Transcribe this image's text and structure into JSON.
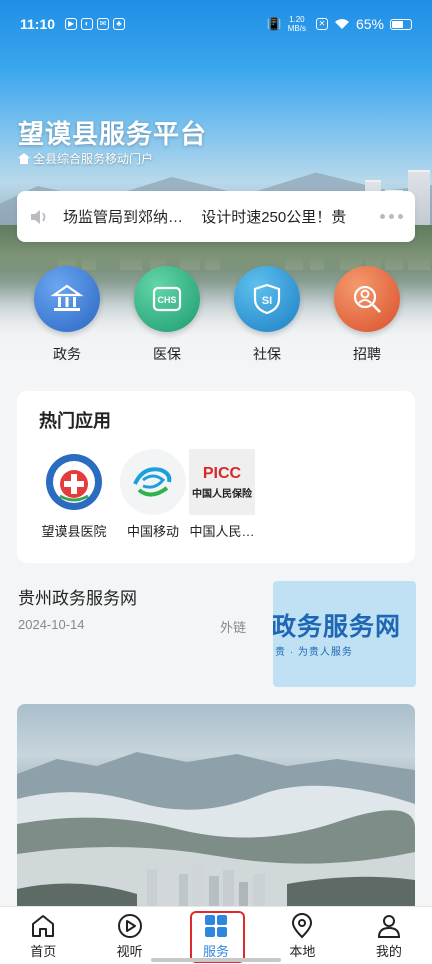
{
  "status_bar": {
    "time": "11:10",
    "net_speed_top": "1.20",
    "net_speed_unit": "MB/s",
    "battery": "65%",
    "battery_level": 0.65
  },
  "header": {
    "title": "望谟县服务平台",
    "subtitle": "全县综合服务移动门户"
  },
  "ticker": {
    "items": [
      "场监管局到郊纳…",
      "设计时速250公里！贵"
    ]
  },
  "quick_services": [
    {
      "label": "政务",
      "icon": "government-building-icon",
      "color": "#3b7fd6"
    },
    {
      "label": "医保",
      "icon": "medical-insurance-icon",
      "color": "#2fb38a"
    },
    {
      "label": "社保",
      "icon": "social-security-icon",
      "color": "#2a95d8"
    },
    {
      "label": "招聘",
      "icon": "recruitment-icon",
      "color": "#e8613a"
    }
  ],
  "hot_apps": {
    "title": "热门应用",
    "items": [
      {
        "name": "望谟县医院",
        "icon": "hospital-logo-icon"
      },
      {
        "name": "中国移动",
        "icon": "china-mobile-logo-icon"
      },
      {
        "name": "中国人民…",
        "icon": "picc-logo-icon",
        "logo_text_top": "PICC",
        "logo_text_bottom": "中国人民保险"
      }
    ]
  },
  "news": {
    "title": "贵州政务服务网",
    "date": "2024-10-14",
    "tag": "外链",
    "thumb_big": "政务服务网",
    "thumb_small": "贵 · 为贵人服务"
  },
  "bottom_nav": {
    "active": "服务",
    "items": [
      {
        "label": "首页",
        "icon": "home-icon"
      },
      {
        "label": "视听",
        "icon": "play-icon"
      },
      {
        "label": "服务",
        "icon": "grid-icon"
      },
      {
        "label": "本地",
        "icon": "location-pin-icon"
      },
      {
        "label": "我的",
        "icon": "person-icon"
      }
    ]
  },
  "colors": {
    "accent": "#2f86e0",
    "highlight_box": "#e02a2a"
  }
}
